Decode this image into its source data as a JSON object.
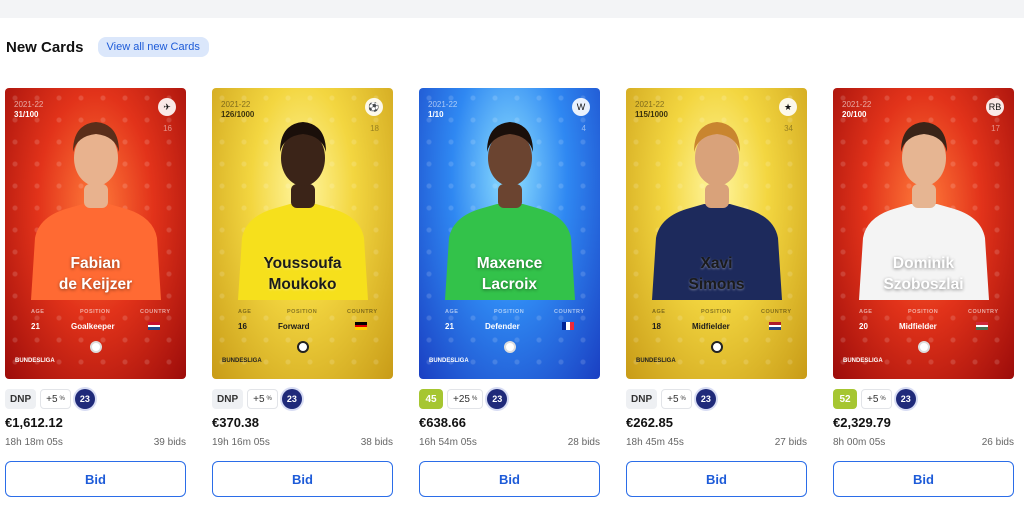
{
  "header": {
    "title": "New Cards",
    "view_all": "View all new Cards"
  },
  "labels": {
    "age": "AGE",
    "position": "POSITION",
    "country": "COUNTRY",
    "bid": "Bid",
    "league": "BUNDESLIGA"
  },
  "cards": [
    {
      "season": "2021-22",
      "serial": "31/100",
      "shirt": "16",
      "first": "Fabian",
      "last": "de Keijzer",
      "age": "21",
      "position": "Goalkeeper",
      "score": "DNP",
      "bonus": "+5",
      "level": "23",
      "price": "€1,612.12",
      "time": "18h 18m 05s",
      "bids": "39 bids",
      "theme": "red",
      "shirt_color": "#ff6a33",
      "skin": "#e8b28e",
      "hair": "#5a2e1a",
      "flag": [
        "#c8102e",
        "#ffffff",
        "#21468b"
      ]
    },
    {
      "season": "2021-22",
      "serial": "126/1000",
      "shirt": "18",
      "first": "Youssoufa",
      "last": "Moukoko",
      "age": "16",
      "position": "Forward",
      "score": "DNP",
      "bonus": "+5",
      "level": "23",
      "price": "€370.38",
      "time": "19h 16m 05s",
      "bids": "38 bids",
      "theme": "gold",
      "shirt_color": "#f6e01c",
      "skin": "#3b2418",
      "hair": "#1a0f0a",
      "flag": [
        "#000000",
        "#dd0000",
        "#ffce00"
      ]
    },
    {
      "season": "2021-22",
      "serial": "1/10",
      "shirt": "4",
      "first": "Maxence",
      "last": "Lacroix",
      "age": "21",
      "position": "Defender",
      "score": "45",
      "bonus": "+25",
      "level": "23",
      "price": "€638.66",
      "time": "16h 54m 05s",
      "bids": "28 bids",
      "theme": "blue",
      "shirt_color": "#33c24a",
      "skin": "#6b4430",
      "hair": "#1a0f0a",
      "flag": [
        "#002395",
        "#ffffff",
        "#ed2939"
      ]
    },
    {
      "season": "2021-22",
      "serial": "115/1000",
      "shirt": "34",
      "first": "Xavi",
      "last": "Simons",
      "age": "18",
      "position": "Midfielder",
      "score": "DNP",
      "bonus": "+5",
      "level": "23",
      "price": "€262.85",
      "time": "18h 45m 45s",
      "bids": "27 bids",
      "theme": "gold",
      "shirt_color": "#1d2a5c",
      "skin": "#d9a27a",
      "hair": "#c9852f",
      "flag": [
        "#ae1c28",
        "#ffffff",
        "#21468b"
      ]
    },
    {
      "season": "2021-22",
      "serial": "20/100",
      "shirt": "17",
      "first": "Dominik",
      "last": "Szoboszlai",
      "age": "20",
      "position": "Midfielder",
      "score": "52",
      "bonus": "+5",
      "level": "23",
      "price": "€2,329.79",
      "time": "8h 00m 05s",
      "bids": "26 bids",
      "theme": "red",
      "shirt_color": "#f4f4f4",
      "skin": "#e6b592",
      "hair": "#3a2418",
      "flag": [
        "#ce2939",
        "#ffffff",
        "#477050"
      ]
    }
  ]
}
